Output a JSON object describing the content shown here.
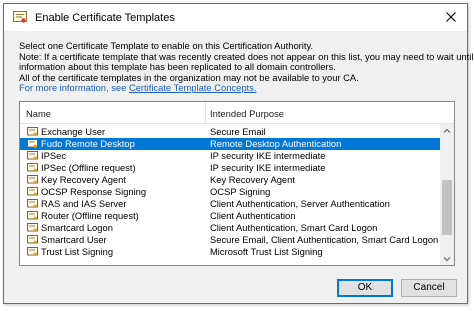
{
  "window": {
    "title": "Enable Certificate Templates"
  },
  "description": {
    "line1": "Select one Certificate Template to enable on this Certification Authority.",
    "line2": "Note: If a certificate template that was recently created does not appear on this list, you may need to wait until",
    "line3": "information about this template has been replicated to all domain controllers.",
    "line4": "All of the certificate templates in the organization may not be available to your CA.",
    "more_info_prefix": "For more information, see ",
    "more_info_link": "Certificate Template Concepts."
  },
  "list": {
    "columns": {
      "name": "Name",
      "purpose": "Intended Purpose"
    },
    "rows": [
      {
        "name": "Exchange User",
        "purpose": "Secure Email",
        "selected": false
      },
      {
        "name": "Fudo Remote Desktop",
        "purpose": "Remote Desktop Authentication",
        "selected": true
      },
      {
        "name": "IPSec",
        "purpose": "IP security IKE intermediate",
        "selected": false
      },
      {
        "name": "IPSec (Offline request)",
        "purpose": "IP security IKE intermediate",
        "selected": false
      },
      {
        "name": "Key Recovery Agent",
        "purpose": "Key Recovery Agent",
        "selected": false
      },
      {
        "name": "OCSP Response Signing",
        "purpose": "OCSP Signing",
        "selected": false
      },
      {
        "name": "RAS and IAS Server",
        "purpose": "Client Authentication, Server Authentication",
        "selected": false
      },
      {
        "name": "Router (Offline request)",
        "purpose": "Client Authentication",
        "selected": false
      },
      {
        "name": "Smartcard Logon",
        "purpose": "Client Authentication, Smart Card Logon",
        "selected": false
      },
      {
        "name": "Smartcard User",
        "purpose": "Secure Email, Client Authentication, Smart Card Logon",
        "selected": false
      },
      {
        "name": "Trust List Signing",
        "purpose": "Microsoft Trust List Signing",
        "selected": false
      }
    ]
  },
  "buttons": {
    "ok": "OK",
    "cancel": "Cancel"
  },
  "colors": {
    "selection": "#0078d7",
    "link": "#1a5fb4",
    "dialog_bg": "#f0f0f0"
  },
  "icons": {
    "app": "certificate-icon",
    "close": "close-icon",
    "row": "certificate-template-icon"
  }
}
